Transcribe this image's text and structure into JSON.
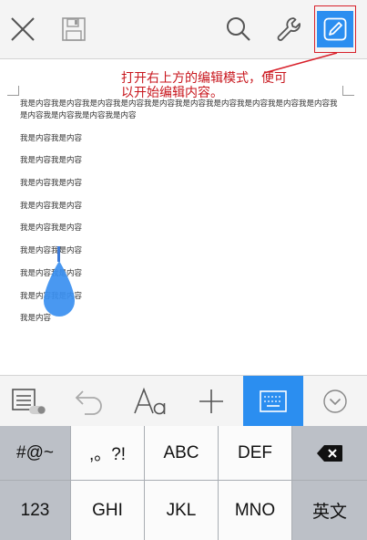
{
  "toolbar": {
    "close_icon": "close-icon",
    "save_icon": "save-icon",
    "search_icon": "search-icon",
    "tools_icon": "wrench-icon",
    "edit_icon": "pencil-icon",
    "edit_bg": "#2b8ef0"
  },
  "annotation": {
    "line1": "打开右上方的编辑模式，便可",
    "line2": "以开始编辑内容。",
    "color": "#c8161d"
  },
  "document": {
    "paragraphs": [
      "我是内容我是内容我是内容我是内容我是内容我是内容我是内容我是内容我是内容我是内容我是内容我是内容我是内容我是内容",
      "我是内容我是内容",
      "我是内容我是内容",
      "我是内容我是内容",
      "我是内容我是内容",
      "我是内容我是内容",
      "我是内容我是内容",
      "我是内容我是内容",
      "我是内容我是内容",
      "我是内容"
    ]
  },
  "bottom_toolbar": {
    "items": [
      "format-toggle-icon",
      "undo-icon",
      "text-style-icon",
      "insert-icon",
      "keyboard-icon",
      "collapse-icon"
    ],
    "active_index": 4,
    "active_color": "#2b8ef0"
  },
  "keyboard": {
    "row1": [
      "#@~",
      ",。?!",
      "ABC",
      "DEF"
    ],
    "row2": [
      "123",
      "GHI",
      "JKL",
      "MNO",
      "英文"
    ],
    "delete_icon": "delete-icon"
  }
}
